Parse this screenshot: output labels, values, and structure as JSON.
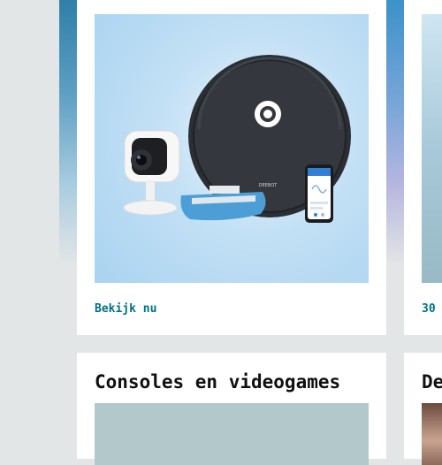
{
  "cards": [
    {
      "title_partial": "",
      "link_label": "Bekijk nu",
      "image_brand": "DEEBOT"
    },
    {
      "link_label": "30"
    }
  ],
  "teasers": [
    {
      "title": "Consoles en videogames"
    },
    {
      "title": "De"
    }
  ],
  "icons": {
    "robot": "robot-vacuum-icon",
    "camera": "security-camera-icon",
    "phone": "smartphone-app-icon",
    "mop": "mop-pad-icon"
  },
  "colors": {
    "page_bg": "#e3e6e6",
    "link": "#007185",
    "title": "#0f1111"
  }
}
